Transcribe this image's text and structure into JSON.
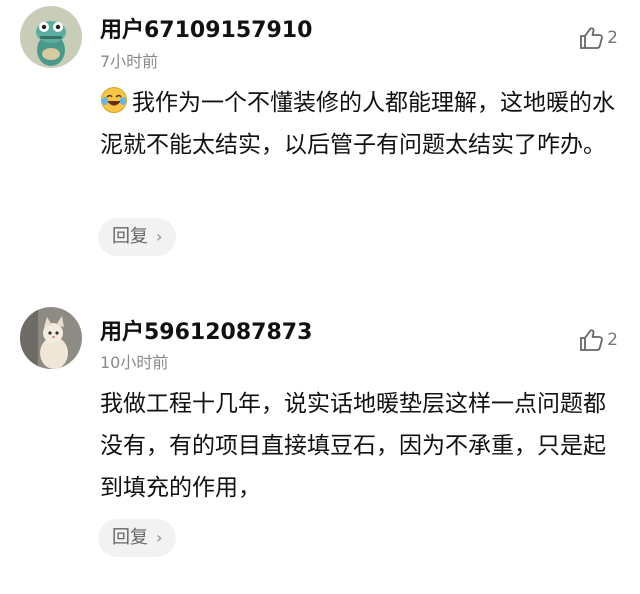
{
  "comments": [
    {
      "username": "用户67109157910",
      "time": "7小时前",
      "likes": "2",
      "text": "我作为一个不懂装修的人都能理解，这地暖的水泥就不能太结实，以后管子有问题太结实了咋办。",
      "reply_label": "回复",
      "avatar_icon": "cartoon-frog-icon",
      "emoji_icon": "laughing-tears-emoji"
    },
    {
      "username": "用户59612087873",
      "time": "10小时前",
      "likes": "2",
      "text": "我做工程十几年，说实话地暖垫层这样一点问题都没有，有的项目直接填豆石，因为不承重，只是起到填充的作用，",
      "reply_label": "回复",
      "avatar_icon": "cat-photo-icon"
    }
  ],
  "colors": {
    "reply_bg": "#f2f2f2",
    "muted": "#8a8a8a",
    "text": "#111111"
  }
}
